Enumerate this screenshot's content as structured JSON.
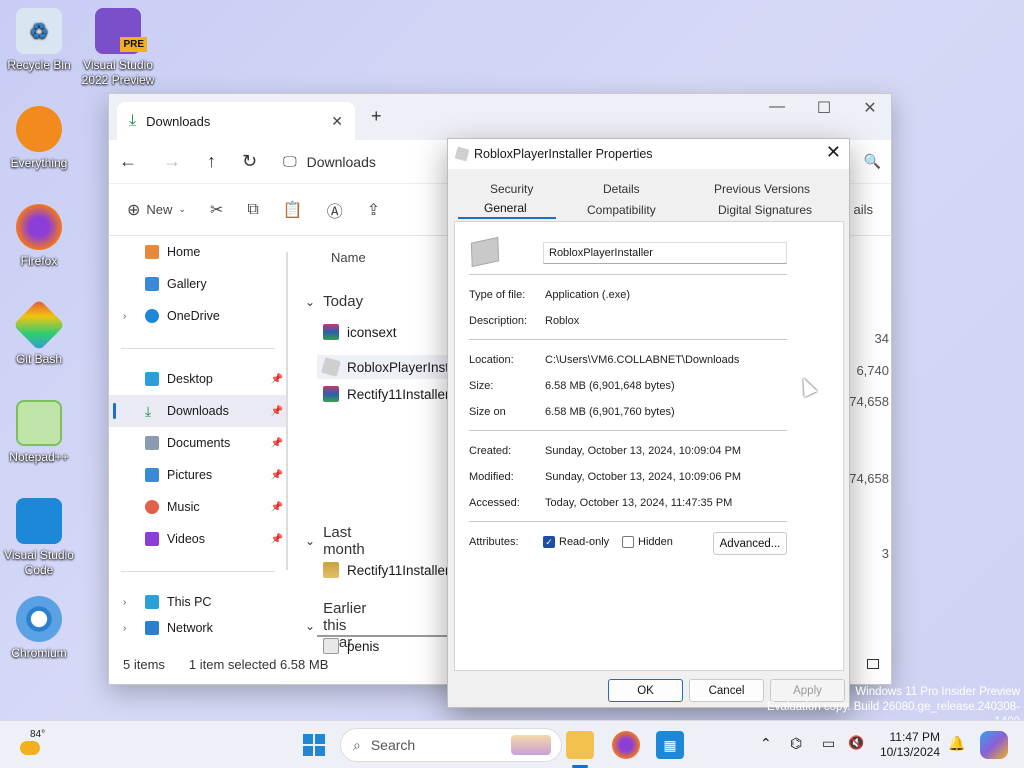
{
  "desktop": {
    "icons": [
      {
        "label": "Recycle Bin"
      },
      {
        "label": "Visual Studio 2022 Preview",
        "badge": "PRE"
      },
      {
        "label": "Everything"
      },
      {
        "label": "Firefox"
      },
      {
        "label": "Git Bash"
      },
      {
        "label": "Notepad++"
      },
      {
        "label": "Visual Studio Code"
      },
      {
        "label": "Chromium"
      }
    ],
    "watermark_line1": "Windows 11 Pro Insider Preview",
    "watermark_line2": "Evaluation copy. Build 26080.ge_release.240308-1400"
  },
  "explorer": {
    "tab_title": "Downloads",
    "breadcrumb": "Downloads",
    "toolbar": {
      "new_label": "New",
      "details_label": "ails"
    },
    "sidebar": {
      "home": "Home",
      "gallery": "Gallery",
      "onedrive": "OneDrive",
      "desktop": "Desktop",
      "downloads": "Downloads",
      "documents": "Documents",
      "pictures": "Pictures",
      "music": "Music",
      "videos": "Videos",
      "thispc": "This PC",
      "network": "Network"
    },
    "columns": {
      "name": "Name",
      "size": "ize"
    },
    "groups": {
      "today": "Today",
      "last_month": "Last month",
      "earlier": "Earlier this year"
    },
    "files": [
      {
        "name": "iconsext",
        "size": "34"
      },
      {
        "name": "RobloxPlayerInsta",
        "size": "6,740"
      },
      {
        "name": "Rectify11Installer",
        "size": "74,658"
      },
      {
        "name": "Rectify11Installer",
        "size": "74,658"
      },
      {
        "name": "penis",
        "size": "3"
      }
    ],
    "status": {
      "items": "5 items",
      "selected": "1 item selected  6.58 MB"
    }
  },
  "properties": {
    "title": "RobloxPlayerInstaller Properties",
    "tabs": {
      "security": "Security",
      "details": "Details",
      "previous": "Previous Versions",
      "general": "General",
      "compat": "Compatibility",
      "signatures": "Digital Signatures"
    },
    "filename": "RobloxPlayerInstaller",
    "rows": {
      "type_k": "Type of file:",
      "type_v": "Application (.exe)",
      "desc_k": "Description:",
      "desc_v": "Roblox",
      "loc_k": "Location:",
      "loc_v": "C:\\Users\\VM6.COLLABNET\\Downloads",
      "size_k": "Size:",
      "size_v": "6.58 MB (6,901,648 bytes)",
      "disk_k": "Size on",
      "disk_v": "6.58 MB (6,901,760 bytes)",
      "created_k": "Created:",
      "created_v": "Sunday, October 13, 2024, 10:09:04 PM",
      "modified_k": "Modified:",
      "modified_v": "Sunday, October 13, 2024, 10:09:06 PM",
      "accessed_k": "Accessed:",
      "accessed_v": "Today, October 13, 2024, 11:47:35 PM",
      "attr_k": "Attributes:"
    },
    "readonly_label": "Read-only",
    "readonly_checked": true,
    "hidden_label": "Hidden",
    "hidden_checked": false,
    "advanced_label": "Advanced...",
    "ok_label": "OK",
    "cancel_label": "Cancel",
    "apply_label": "Apply"
  },
  "taskbar": {
    "weather": "84°",
    "search_placeholder": "Search",
    "time": "11:47 PM",
    "date": "10/13/2024"
  },
  "colors": {
    "accent": "#1b6fc6",
    "taskbar": "#eef0f7",
    "desktop": "#cfd2f3"
  }
}
